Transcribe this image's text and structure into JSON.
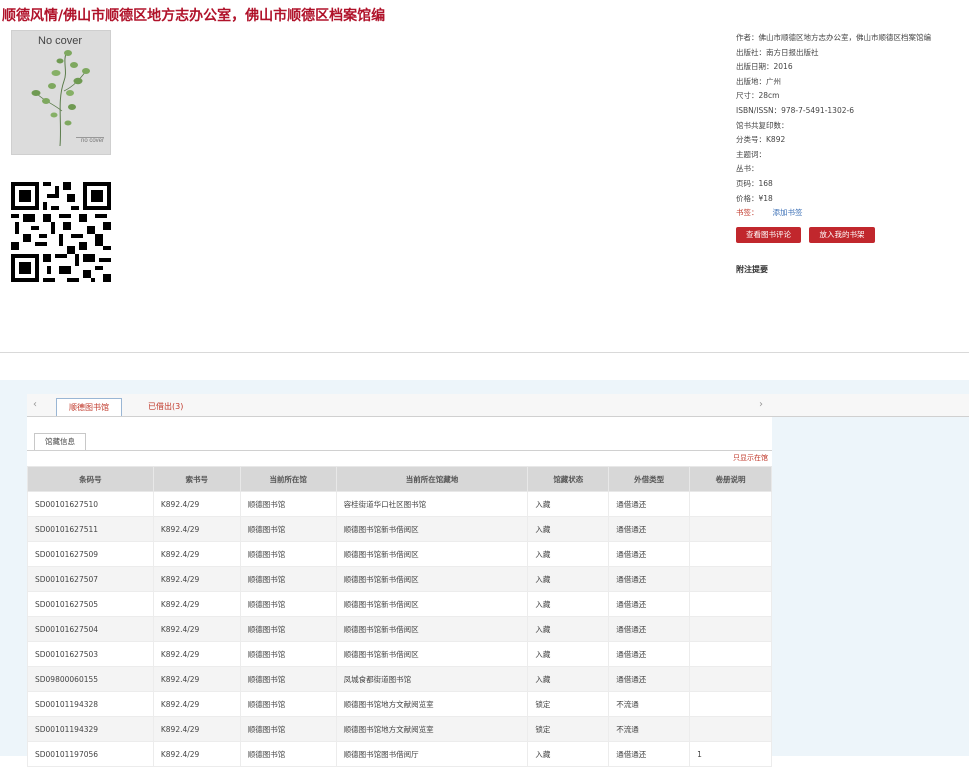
{
  "book": {
    "title": "顺德风情/佛山市顺德区地方志办公室，佛山市顺德区档案馆编",
    "cover_text": "No cover",
    "cover_small_text": "no cover"
  },
  "meta": [
    {
      "label": "作者：",
      "value": "佛山市顺德区地方志办公室，佛山市顺德区档案馆编"
    },
    {
      "label": "出版社：",
      "value": "南方日报出版社"
    },
    {
      "label": "出版日期：",
      "value": "2016"
    },
    {
      "label": "出版地：",
      "value": "广州"
    },
    {
      "label": "尺寸：",
      "value": "28cm"
    },
    {
      "label": "ISBN/ISSN：",
      "value": "978-7-5491-1302-6"
    },
    {
      "label": "馆书共复印数：",
      "value": ""
    },
    {
      "label": "分类号：",
      "value": "K892"
    },
    {
      "label": "主题词：",
      "value": ""
    },
    {
      "label": "丛书：",
      "value": ""
    },
    {
      "label": "页码：",
      "value": "168"
    },
    {
      "label": "价格：",
      "value": "¥18"
    }
  ],
  "bookshelf": {
    "label": "书签：",
    "link": "添加书签"
  },
  "buttons": {
    "review": "查看图书评论",
    "add_shelf": "放入我的书架"
  },
  "note_title": "附注提要",
  "tabs": {
    "library": "顺德图书馆",
    "lent": "已借出(3)"
  },
  "subtab": "馆藏信息",
  "only_available": "只显示在馆",
  "table": {
    "headers": [
      "条码号",
      "索书号",
      "当前所在馆",
      "当前所在馆藏地",
      "馆藏状态",
      "外借类型",
      "卷册说明"
    ],
    "rows": [
      [
        "SD00101627510",
        "K892.4/29",
        "顺德图书馆",
        "容桂街道华口社区图书馆",
        "入藏",
        "通借通还",
        ""
      ],
      [
        "SD00101627511",
        "K892.4/29",
        "顺德图书馆",
        "顺德图书馆新书借阅区",
        "入藏",
        "通借通还",
        ""
      ],
      [
        "SD00101627509",
        "K892.4/29",
        "顺德图书馆",
        "顺德图书馆新书借阅区",
        "入藏",
        "通借通还",
        ""
      ],
      [
        "SD00101627507",
        "K892.4/29",
        "顺德图书馆",
        "顺德图书馆新书借阅区",
        "入藏",
        "通借通还",
        ""
      ],
      [
        "SD00101627505",
        "K892.4/29",
        "顺德图书馆",
        "顺德图书馆新书借阅区",
        "入藏",
        "通借通还",
        ""
      ],
      [
        "SD00101627504",
        "K892.4/29",
        "顺德图书馆",
        "顺德图书馆新书借阅区",
        "入藏",
        "通借通还",
        ""
      ],
      [
        "SD00101627503",
        "K892.4/29",
        "顺德图书馆",
        "顺德图书馆新书借阅区",
        "入藏",
        "通借通还",
        ""
      ],
      [
        "SD09800060155",
        "K892.4/29",
        "顺德图书馆",
        "凤城食都街道图书馆",
        "入藏",
        "通借通还",
        ""
      ],
      [
        "SD00101194328",
        "K892.4/29",
        "顺德图书馆",
        "顺德图书馆地方文献阅览室",
        "锁定",
        "不流通",
        ""
      ],
      [
        "SD00101194329",
        "K892.4/29",
        "顺德图书馆",
        "顺德图书馆地方文献阅览室",
        "锁定",
        "不流通",
        ""
      ],
      [
        "SD00101197056",
        "K892.4/29",
        "顺德图书馆",
        "顺德图书馆图书借阅厅",
        "入藏",
        "通借通还",
        "1"
      ]
    ]
  }
}
